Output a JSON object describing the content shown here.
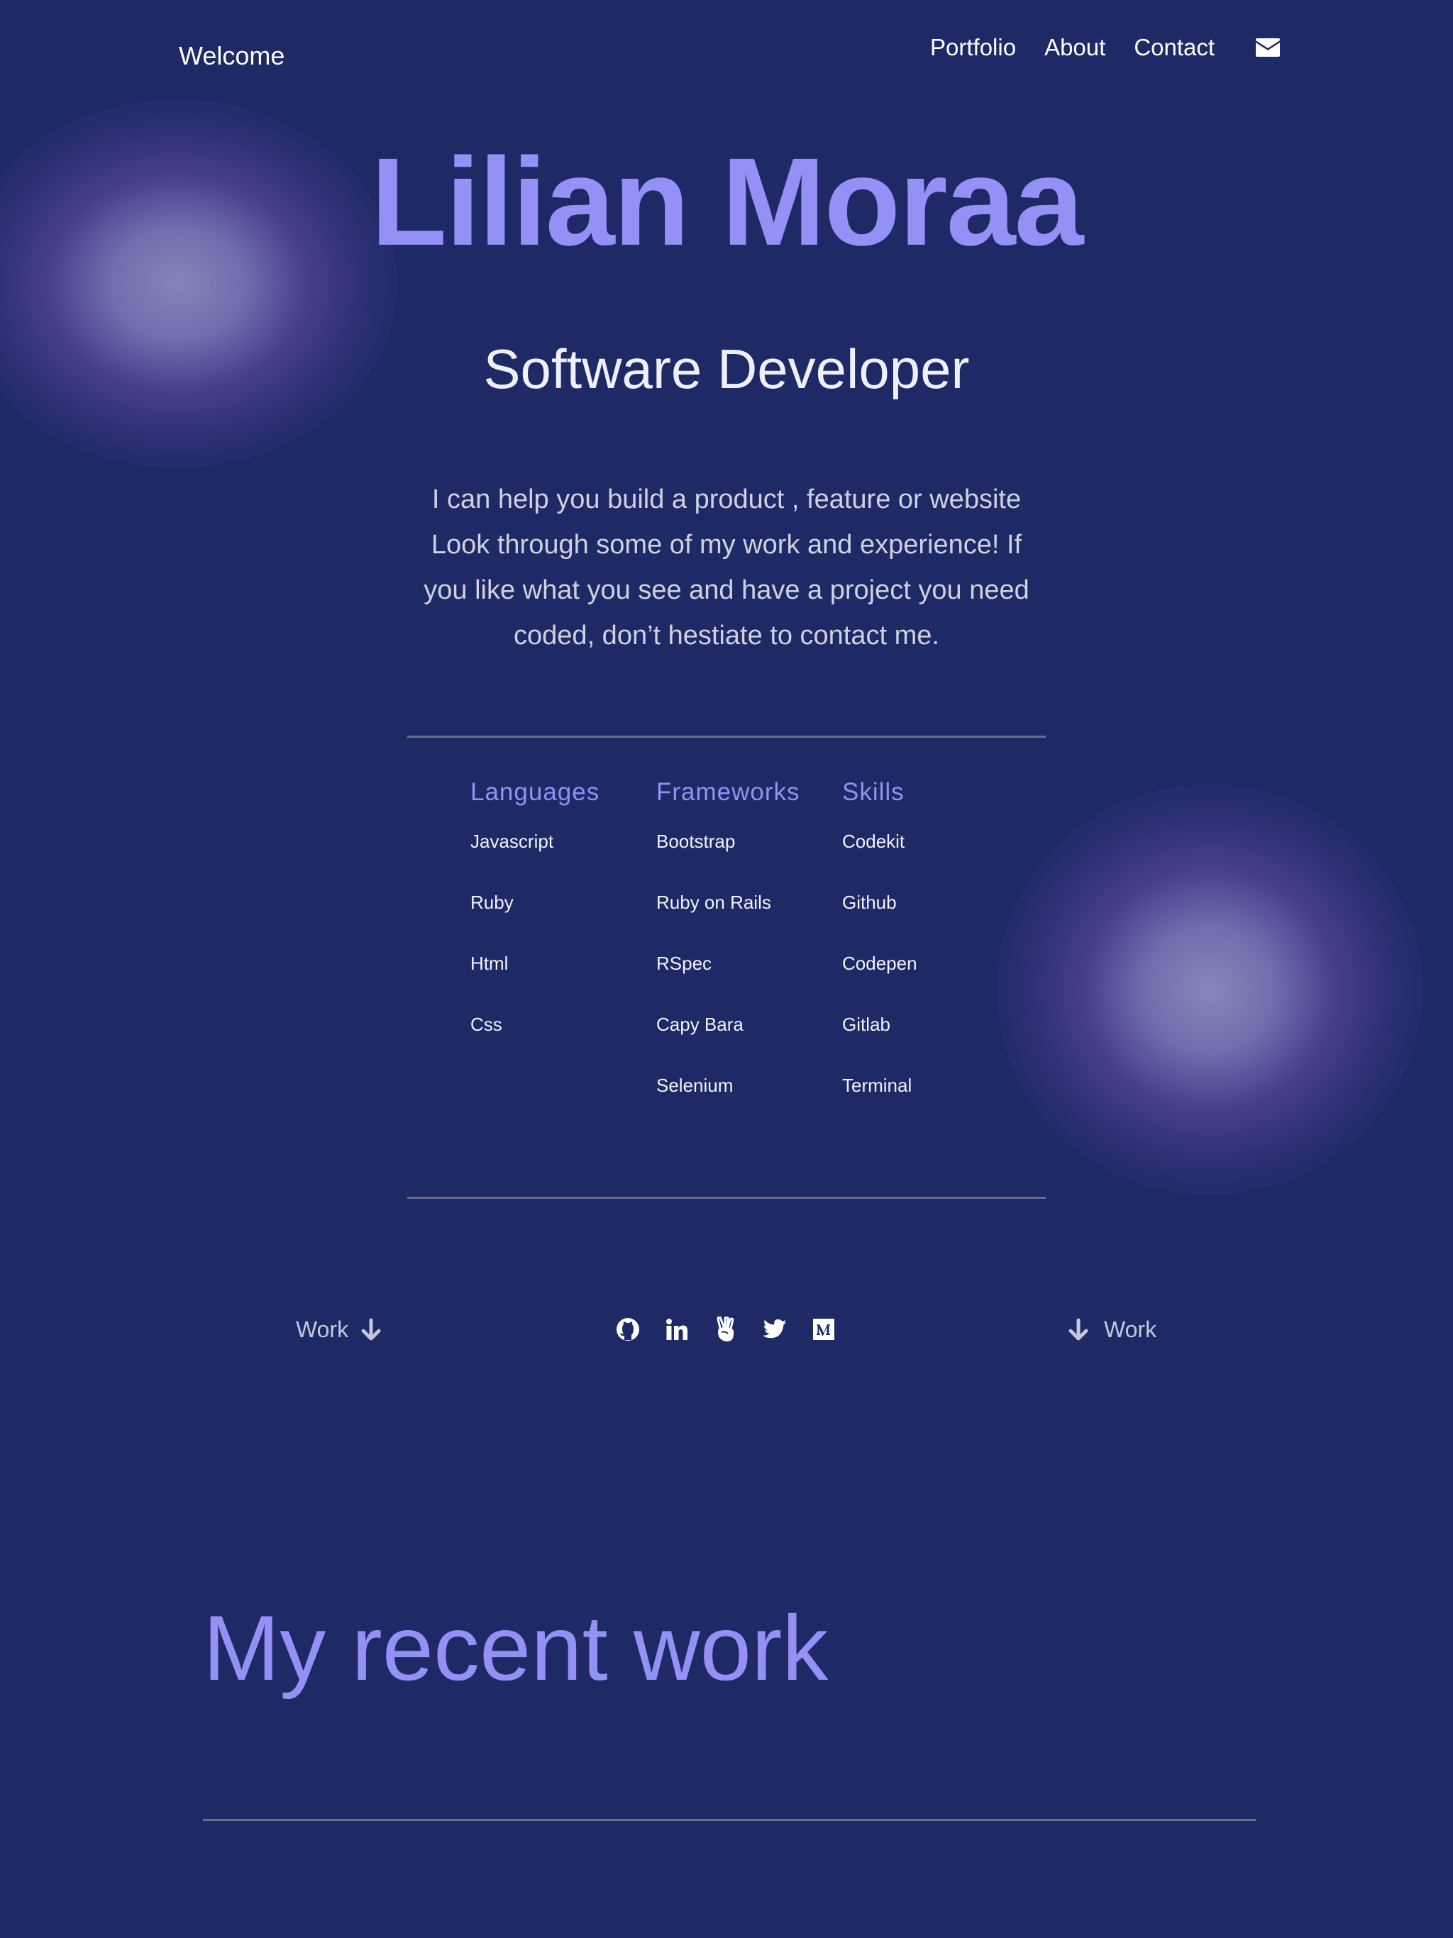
{
  "header": {
    "brand": "Welcome",
    "nav": [
      "Portfolio",
      "About",
      "Contact"
    ],
    "mail_icon": "envelope-icon"
  },
  "hero": {
    "name": "Lilian Moraa",
    "role": "Software Developer",
    "description": "I can help you build a product , feature or website Look through some of my work and experience! If you like what you see and have a project you need coded, don’t hestiate to contact me."
  },
  "skills": {
    "languages": {
      "title": "Languages",
      "items": [
        "Javascript",
        "Ruby",
        "Html",
        "Css"
      ]
    },
    "frameworks": {
      "title": "Frameworks",
      "items": [
        "Bootstrap",
        "Ruby on Rails",
        "RSpec",
        "Capy Bara",
        "Selenium"
      ]
    },
    "skills": {
      "title": "Skills",
      "items": [
        "Codekit",
        "Github",
        "Codepen",
        "Gitlab",
        "Terminal"
      ]
    }
  },
  "work_links": {
    "left": "Work",
    "right": "Work"
  },
  "socials": [
    "github-icon",
    "linkedin-icon",
    "angellist-icon",
    "twitter-icon",
    "medium-icon"
  ],
  "recent_work": {
    "title": "My recent work"
  },
  "colors": {
    "background": "#1e2a65",
    "accent": "#9590f5",
    "text": "#ffffff",
    "muted": "#c4c6dc",
    "rule": "#6c6e86"
  }
}
